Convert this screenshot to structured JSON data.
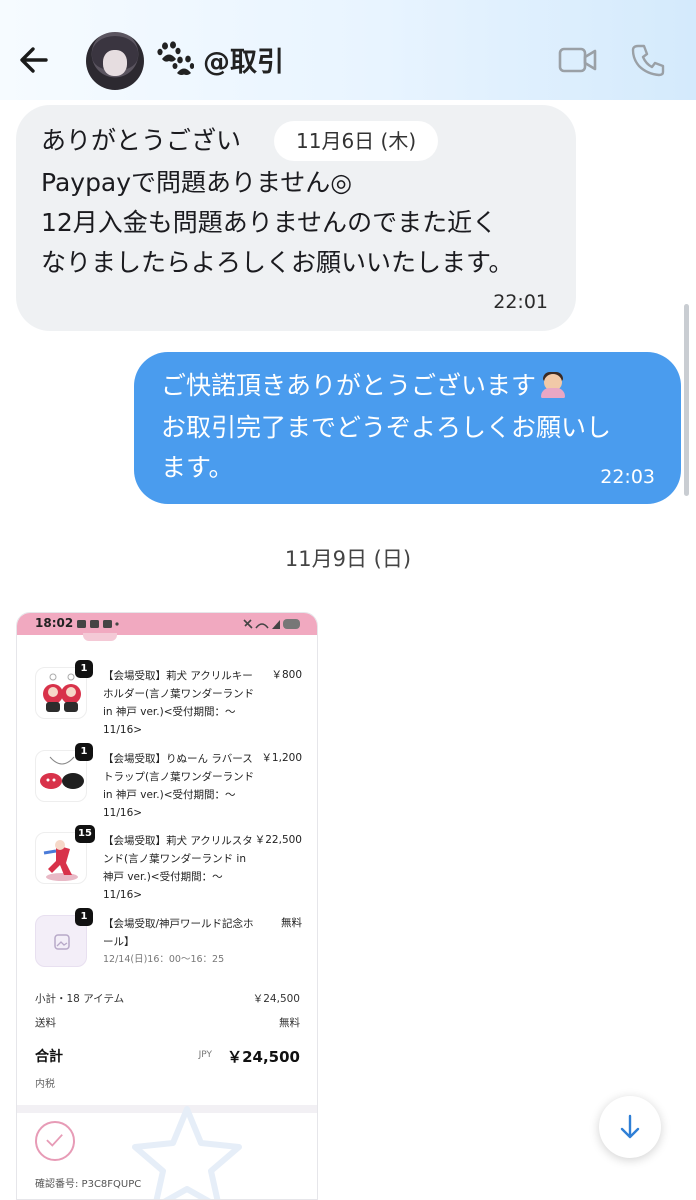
{
  "header": {
    "title": "@取引",
    "paw_emoji": "paw-prints-icon",
    "video_icon": "video-camera-icon",
    "phone_icon": "phone-icon",
    "back_icon": "back-arrow-icon"
  },
  "messages": [
    {
      "direction": "incoming",
      "lines": [
        "ありがとうござい",
        "Paypayで問題ありません◎",
        "12月入金も問題ありませんのでまた近く",
        "なりましたらよろしくお願いいたします。"
      ],
      "time": "22:01",
      "date_overlay": "11月6日 (木)"
    },
    {
      "direction": "outgoing",
      "lines": [
        "ご快諾頂きありがとうございます",
        "お取引完了までどうぞよろしくお願いし",
        "ます。"
      ],
      "time": "22:03"
    }
  ],
  "date_separator": "11月9日 (日)",
  "shared_image": {
    "status_time": "18:02",
    "items": [
      {
        "qty": "1",
        "name": "【会場受取】莉犬 アクリルキーホルダー(言ノ葉ワンダーランド in 神戸 ver.)<受付期間：〜11/16>",
        "price": "￥800"
      },
      {
        "qty": "1",
        "name": "【会場受取】りぬーん ラバーストラップ(言ノ葉ワンダーランド in 神戸 ver.)<受付期間：〜11/16>",
        "price": "￥1,200"
      },
      {
        "qty": "15",
        "name": "【会場受取】莉犬 アクリルスタンド(言ノ葉ワンダーランド in 神戸 ver.)<受付期間：〜11/16>",
        "price": "￥22,500"
      },
      {
        "qty": "1",
        "name": "【会場受取/神戸ワールド記念ホール】",
        "price": "無料",
        "sub": "12/14(日)16：00〜16：25"
      }
    ],
    "subtotal_label": "小計・18 アイテム",
    "subtotal_value": "￥24,500",
    "shipping_label": "送料",
    "shipping_value": "無料",
    "total_label": "合計",
    "total_currency": "JPY",
    "total_value": "￥24,500",
    "tax_note": "内税",
    "confirmation": "確認番号: P3C8FQUPC"
  },
  "colors": {
    "outgoing_bubble": "#4a9cee",
    "incoming_bubble": "#eff1f3",
    "status_bar_pink": "#f1a9c0",
    "scroll_arrow": "#2f7fd6"
  }
}
